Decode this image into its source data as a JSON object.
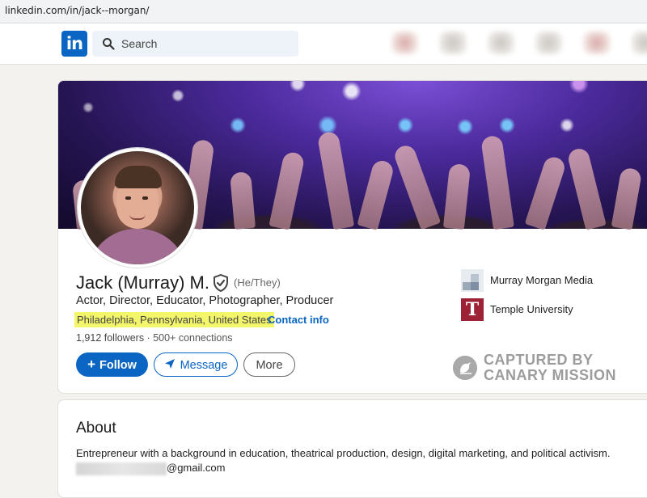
{
  "browser": {
    "url": "linkedin.com/in/jack--morgan/"
  },
  "topnav": {
    "logo_text": "in",
    "search_placeholder": "Search"
  },
  "profile": {
    "name": "Jack (Murray) M.",
    "pronouns": "(He/They)",
    "headline": "Actor, Director, Educator, Photographer, Producer",
    "location": "Philadelphia, Pennsylvania, United States",
    "separator": "·",
    "contact_info": "Contact info",
    "followers": "1,912 followers",
    "connections": "500+ connections",
    "stats_separator": " · ",
    "buttons": {
      "follow": "Follow",
      "message": "Message",
      "more": "More"
    },
    "companies": [
      {
        "name": "Murray Morgan Media",
        "icon": "company-logo-icon"
      },
      {
        "name": "Temple University",
        "icon": "temple-t-icon",
        "letter": "T"
      }
    ]
  },
  "watermark": {
    "line1": "CAPTURED BY",
    "line2": "CANARY MISSION"
  },
  "about": {
    "title": "About",
    "text": "Entrepreneur with a background in education, theatrical production, design, digital marketing, and political activism.",
    "email_suffix": "@gmail.com"
  },
  "colors": {
    "brand": "#0a66c2",
    "highlight": "#f3f56a",
    "temple": "#9d2235",
    "page_bg": "#f4f2ee"
  }
}
